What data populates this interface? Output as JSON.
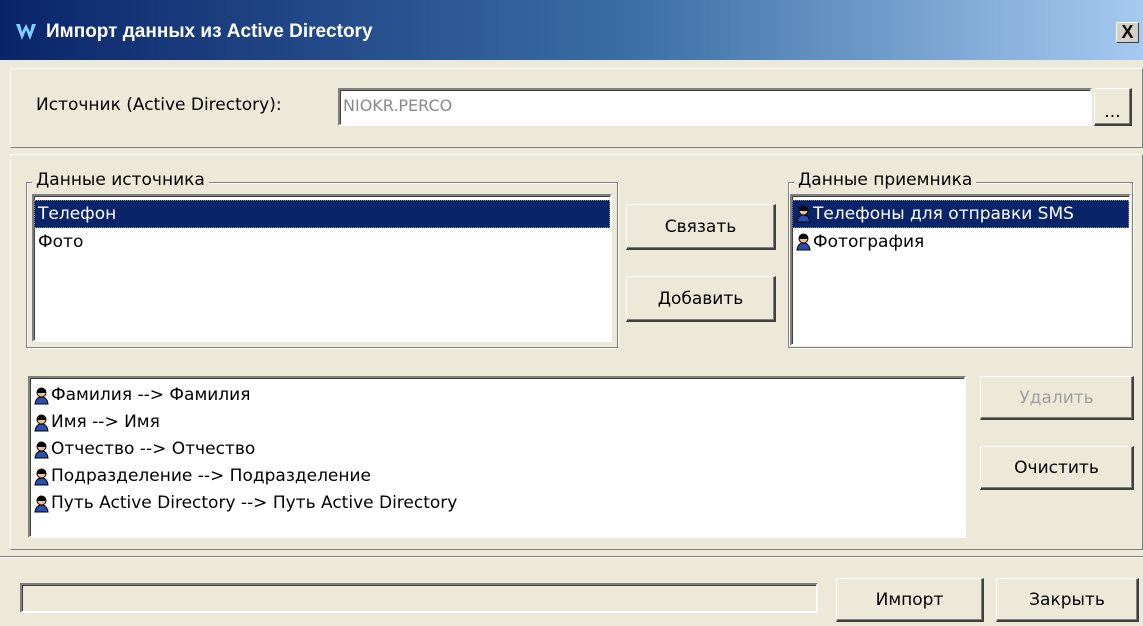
{
  "window": {
    "title": "Импорт данных из Active Directory",
    "close_label": "X"
  },
  "source": {
    "label": "Источник (Active Directory):",
    "value": "NIOKR.PERCO",
    "browse_label": "..."
  },
  "source_data": {
    "title": "Данные источника",
    "items": [
      {
        "label": "Телефон",
        "selected": true
      },
      {
        "label": "Фото",
        "selected": false
      }
    ]
  },
  "receiver_data": {
    "title": "Данные приемника",
    "items": [
      {
        "label": "Телефоны для отправки SMS",
        "selected": true,
        "icon": "user-icon"
      },
      {
        "label": "Фотография",
        "selected": false,
        "icon": "user-icon"
      }
    ]
  },
  "actions": {
    "link_label": "Связать",
    "add_label": "Добавить",
    "delete_label": "Удалить",
    "clear_label": "Очистить"
  },
  "mappings": [
    {
      "label": "Фамилия --> Фамилия",
      "icon": "user-icon"
    },
    {
      "label": "Имя --> Имя",
      "icon": "user-icon"
    },
    {
      "label": "Отчество --> Отчество",
      "icon": "user-icon"
    },
    {
      "label": "Подразделение --> Подразделение",
      "icon": "user-icon"
    },
    {
      "label": "Путь Active Directory --> Путь Active Directory",
      "icon": "user-icon"
    }
  ],
  "footer": {
    "import_label": "Импорт",
    "close_label": "Закрыть",
    "progress": 0
  },
  "colors": {
    "selection": "#0a246a",
    "window_bg": "#ece9d8"
  }
}
